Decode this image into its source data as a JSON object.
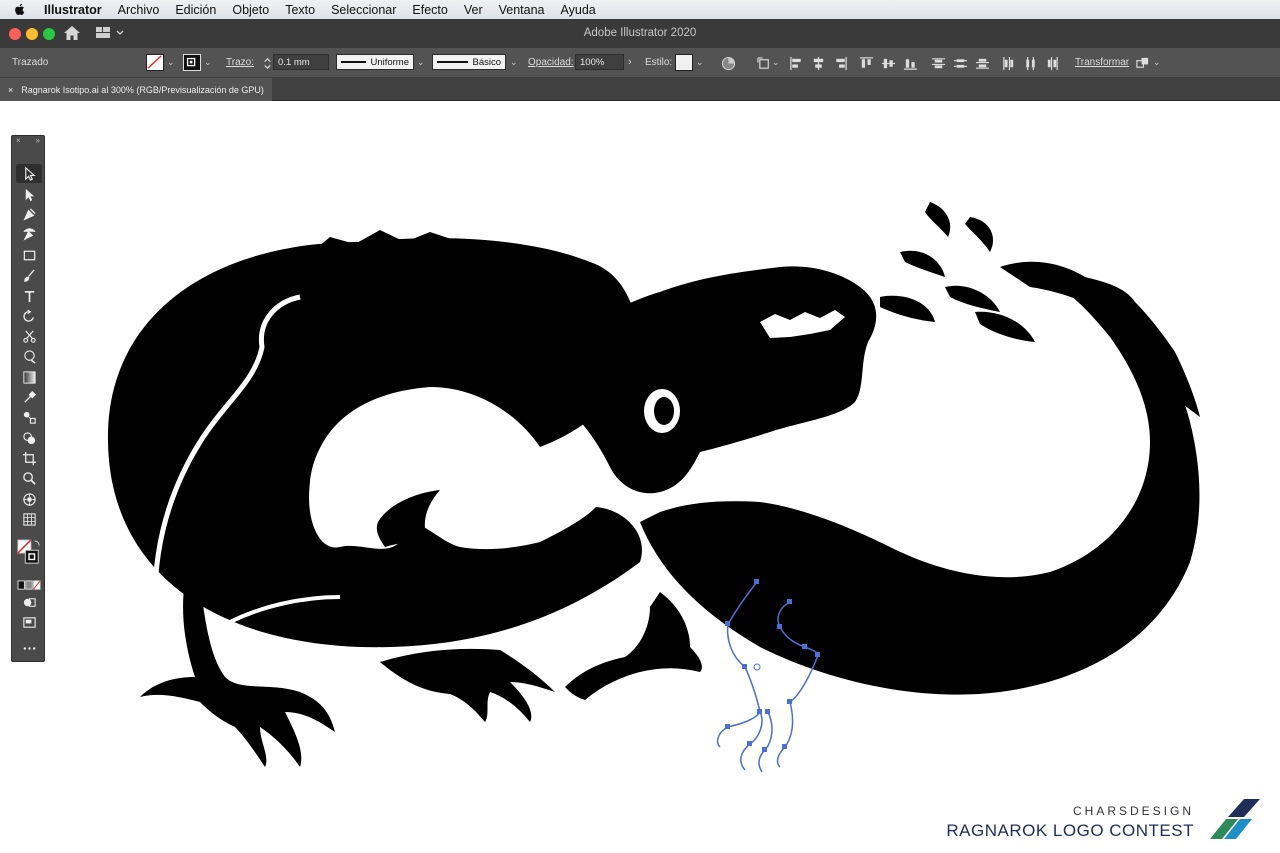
{
  "menubar": {
    "app": "Illustrator",
    "menus": [
      "Archivo",
      "Edición",
      "Objeto",
      "Texto",
      "Seleccionar",
      "Efecto",
      "Ver",
      "Ventana",
      "Ayuda"
    ]
  },
  "window": {
    "title": "Adobe Illustrator 2020"
  },
  "controlbar": {
    "selection_label": "Trazado",
    "stroke_label": "Trazo:",
    "stroke_weight": "0.1 mm",
    "profile": "Uniforme",
    "brush": "Básico",
    "opacity_label": "Opacidad:",
    "opacity_value": "100%",
    "style_label": "Estilo:",
    "transform_label": "Transformar"
  },
  "document": {
    "tab_close": "×",
    "tab_title": "Ragnarok Isotipo.ai al 300% (RGB/Previsualización de GPU)"
  },
  "toolbar": {
    "tools": [
      "selection",
      "direct-selection",
      "pen",
      "curvature",
      "rectangle",
      "paintbrush",
      "type",
      "rotate",
      "scissors",
      "warp",
      "gradient",
      "eyedropper",
      "blend",
      "shape-builder",
      "artboard",
      "zoom",
      "symbol-sprayer",
      "graph",
      "fill-stroke",
      "color-mode",
      "screen-mode",
      "more-tools"
    ]
  },
  "colors": {
    "menubar": "#e4e6eb",
    "titlebar": "#3a3a3a",
    "controlbar": "#535353",
    "path_selection": "#4a6fd8",
    "artwork": "#000000",
    "brand": "#1e2e58"
  },
  "brand": {
    "top": "CHARSDESIGN",
    "bottom": "RAGNAROK LOGO CONTEST"
  }
}
